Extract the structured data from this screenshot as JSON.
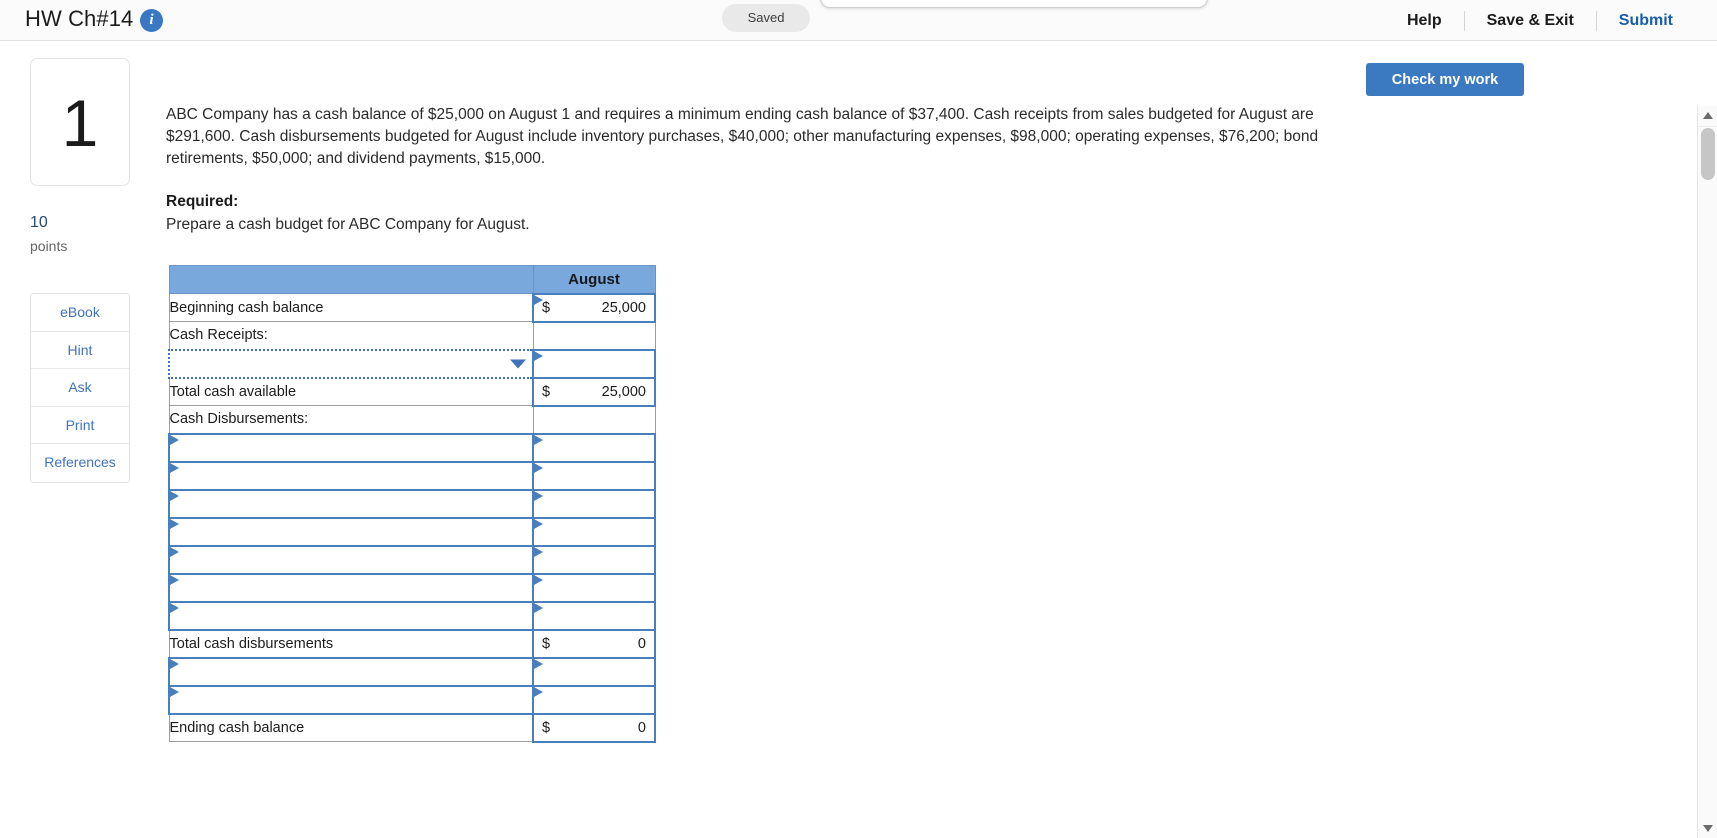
{
  "header": {
    "title": "HW Ch#14",
    "info_icon": "info-icon",
    "saved_status": "Saved",
    "actions": [
      {
        "label": "Help",
        "style": "dark"
      },
      {
        "label": "Save & Exit",
        "style": "dark"
      },
      {
        "label": "Submit",
        "style": "blue"
      }
    ]
  },
  "sidebar": {
    "question_number": "1",
    "points_value": "10",
    "points_label": "points",
    "tools": [
      {
        "label": "eBook"
      },
      {
        "label": "Hint"
      },
      {
        "label": "Ask"
      },
      {
        "label": "Print"
      },
      {
        "label": "References"
      }
    ]
  },
  "toolbar": {
    "check_my_work_label": "Check my work"
  },
  "question": {
    "body": "ABC Company has a cash balance of $25,000 on August 1 and requires a minimum ending cash balance of $37,400. Cash receipts from sales budgeted for August are $291,600. Cash disbursements budgeted for August include inventory purchases, $40,000; other manufacturing expenses, $98,000; operating expenses, $76,200; bond retirements, $50,000; and dividend payments, $15,000.",
    "required_heading": "Required:",
    "required_body": "Prepare a cash budget for ABC Company for August."
  },
  "worksheet": {
    "column_header": "August",
    "rows": [
      {
        "type": "plain",
        "label": "Beginning cash balance",
        "value_kind": "amount",
        "dollar": "$",
        "amount": "25,000"
      },
      {
        "type": "plain",
        "label": "Cash Receipts:",
        "value_kind": "empty-plain"
      },
      {
        "type": "dropdown",
        "label": "",
        "value_kind": "edit"
      },
      {
        "type": "plain",
        "label": "Total cash available",
        "value_kind": "subtotal",
        "dollar": "$",
        "amount": "25,000"
      },
      {
        "type": "plain",
        "label": "Cash Disbursements:",
        "value_kind": "empty-plain"
      },
      {
        "type": "edit",
        "label": "",
        "value_kind": "edit"
      },
      {
        "type": "edit",
        "label": "",
        "value_kind": "edit"
      },
      {
        "type": "edit",
        "label": "",
        "value_kind": "edit"
      },
      {
        "type": "edit",
        "label": "",
        "value_kind": "edit"
      },
      {
        "type": "edit",
        "label": "",
        "value_kind": "edit"
      },
      {
        "type": "edit",
        "label": "",
        "value_kind": "edit"
      },
      {
        "type": "edit",
        "label": "",
        "value_kind": "edit"
      },
      {
        "type": "plain",
        "label": "Total cash disbursements",
        "value_kind": "subtotal",
        "dollar": "$",
        "amount": "0"
      },
      {
        "type": "edit",
        "label": "",
        "value_kind": "edit"
      },
      {
        "type": "edit",
        "label": "",
        "value_kind": "edit"
      },
      {
        "type": "plain",
        "label": "Ending cash balance",
        "value_kind": "subtotal",
        "dollar": "$",
        "amount": "0"
      }
    ]
  },
  "colors": {
    "accent_blue": "#3b7ac0",
    "header_fill": "#79a8dd",
    "link_blue": "#3f73bc",
    "cell_outline": "#4a7fbd"
  }
}
